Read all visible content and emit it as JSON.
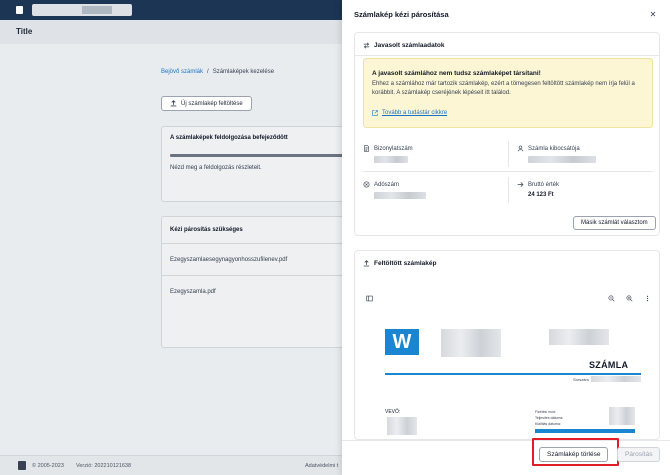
{
  "app": {
    "title": "Title"
  },
  "breadcrumb": {
    "link": "Bejövő számlák",
    "separator": "/",
    "current": "Számlaképek kezelése"
  },
  "upload_button": {
    "label": "Új számlakép feltöltése"
  },
  "processing_card": {
    "title": "A számlaképek feldolgozása befejeződött",
    "text": "Nézd meg a feldolgozás részleteit.",
    "progress": 1.0
  },
  "manual_card": {
    "title": "Kézi párosítás szükséges",
    "files": [
      "Ezegyszamlaesegynagyonhosszufilenev.pdf",
      "Ezegyszamla.pdf"
    ]
  },
  "footer": {
    "copyright": "© 2005-2023",
    "version": "Verzió: 202210121638",
    "right_text": "Adatvédelmi t"
  },
  "drawer": {
    "title": "Számlakép kézi párosítása",
    "close_icon": "close-icon",
    "suggested": {
      "heading": "Javasolt számlaadatok",
      "warning": {
        "title": "A javasolt számlához nem tudsz számlaképet társítani!",
        "text": "Ehhez a számlához már tartozik számlakép, ezért a tömegesen feltöltött számlakép nem írja felül a korábbit. A számlakép cseréjének lépéseit itt találod.",
        "link": "Tovább a tudástár cikkre"
      },
      "fields": {
        "receipt_no_label": "Bizonylatszám",
        "issuer_label": "Számla kibocsátója",
        "tax_no_label": "Adószám",
        "gross_label": "Bruttó érték",
        "gross_value": "24 123 Ft"
      },
      "other_button": "Másik számlát választom"
    },
    "uploaded": {
      "heading": "Feltöltött számlakép",
      "preview": {
        "logo_letter": "W",
        "doc_title": "SZÁMLA",
        "serial_label": "Sorszám",
        "buyer_label": "VEVŐ:",
        "meta_lines": [
          "Fizetési mód:",
          "Teljesítés dátuma:",
          "Kiállítás dátuma:"
        ]
      }
    },
    "footer": {
      "delete_label": "Számlakép törlése",
      "pair_label": "Párosítás"
    }
  },
  "colors": {
    "accent": "#1a73c9",
    "warning_bg": "#fdf6d4",
    "highlight": "#e11d2a",
    "topbar": "#1c3554"
  }
}
